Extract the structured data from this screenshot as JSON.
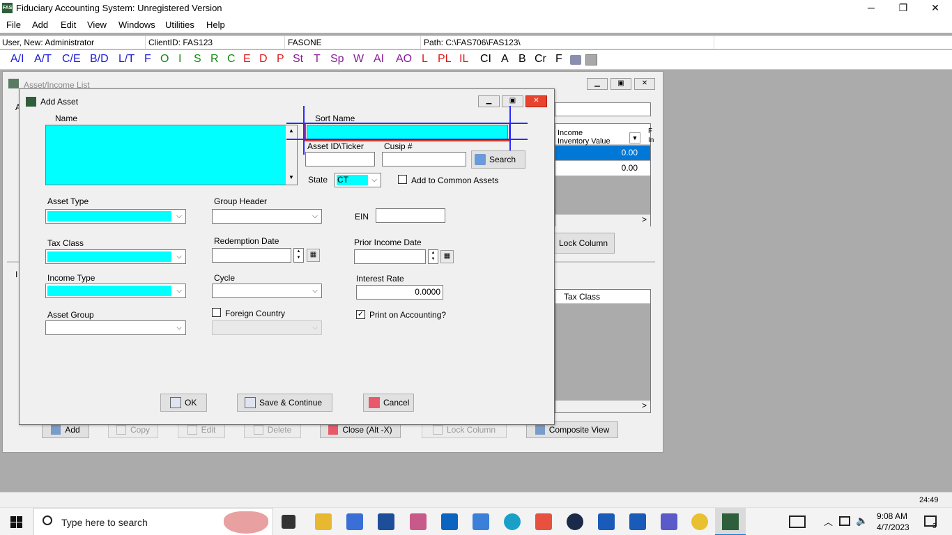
{
  "window": {
    "title": "Fiduciary Accounting System: Unregistered Version",
    "app_icon_text": "FAS",
    "minimize": "─",
    "restore": "❐",
    "close": "✕"
  },
  "menu": [
    "File",
    "Add",
    "Edit",
    "View",
    "Windows",
    "Utilities",
    "Help"
  ],
  "status": {
    "user": "User, New: Administrator",
    "client": "ClientID: FAS123",
    "name": "FASONE",
    "path": "Path: C:\\FAS706\\FAS123\\"
  },
  "toolbar": [
    {
      "label": "A/I",
      "color": "#1a1ad8"
    },
    {
      "label": "A/T",
      "color": "#1a1ad8"
    },
    {
      "label": "C/E",
      "color": "#1a1ad8"
    },
    {
      "label": "B/D",
      "color": "#1a1ad8"
    },
    {
      "label": "L/T",
      "color": "#1a1ad8"
    },
    {
      "label": "F",
      "color": "#1a1ad8"
    },
    {
      "label": "O",
      "color": "#118a11"
    },
    {
      "label": "I",
      "color": "#118a11"
    },
    {
      "label": "S",
      "color": "#118a11"
    },
    {
      "label": "R",
      "color": "#118a11"
    },
    {
      "label": "C",
      "color": "#118a11"
    },
    {
      "label": "E",
      "color": "#e01818"
    },
    {
      "label": "D",
      "color": "#e01818"
    },
    {
      "label": "P",
      "color": "#e01818"
    },
    {
      "label": "St",
      "color": "#8a1a9a"
    },
    {
      "label": "T",
      "color": "#8a1a9a"
    },
    {
      "label": "Sp",
      "color": "#8a1a9a"
    },
    {
      "label": "W",
      "color": "#8a1a9a"
    },
    {
      "label": "AI",
      "color": "#8a1a9a"
    },
    {
      "label": "AO",
      "color": "#8a1a9a"
    },
    {
      "label": "L",
      "color": "#e01818"
    },
    {
      "label": "PL",
      "color": "#e01818"
    },
    {
      "label": "IL",
      "color": "#e01818"
    },
    {
      "label": "CI",
      "color": "#000000"
    },
    {
      "label": "A",
      "color": "#000000"
    },
    {
      "label": "B",
      "color": "#000000"
    },
    {
      "label": "Cr",
      "color": "#000000"
    },
    {
      "label": "F",
      "color": "#000000"
    }
  ],
  "bg_window": {
    "title": "Asset/Income List",
    "letter_a": "A",
    "letter_i": "I",
    "col_income": "Income",
    "col_inventory": "Inventory Value",
    "col_f": "F",
    "col_in": "In",
    "row1_value": "0.00",
    "row2_value": "0.00",
    "lock_column": "Lock Column",
    "tax_class_header": "Tax Class",
    "scroll_right": ">",
    "buttons": {
      "add": "Add",
      "copy": "Copy",
      "edit": "Edit",
      "delete": "Delete",
      "close": "Close (Alt -X)",
      "lock": "Lock Column",
      "composite": "Composite View"
    }
  },
  "dialog": {
    "title": "Add Asset",
    "name_label": "Name",
    "sort_name_label": "Sort Name",
    "ticker_label": "Asset ID\\Ticker",
    "cusip_label": "Cusip #",
    "search_button": "Search",
    "state_label": "State",
    "state_value": "CT",
    "common_assets_label": "Add to Common Assets",
    "asset_type_label": "Asset Type",
    "group_header_label": "Group Header",
    "ein_label": "EIN",
    "tax_class_label": "Tax Class",
    "redemption_label": "Redemption Date",
    "prior_income_label": "Prior Income Date",
    "income_type_label": "Income Type",
    "cycle_label": "Cycle",
    "interest_label": "Interest Rate",
    "interest_value": "0.0000",
    "asset_group_label": "Asset Group",
    "foreign_country_label": "Foreign Country",
    "print_label": "Print on Accounting?",
    "print_checked": "✓",
    "ok_button": "OK",
    "save_continue_button": "Save & Continue",
    "cancel_button": "Cancel"
  },
  "status_bar": {
    "time": "24:49"
  },
  "taskbar": {
    "search_placeholder": "Type here to search",
    "clock_time": "9:08 AM",
    "clock_date": "4/7/2023",
    "notifications": "3"
  }
}
